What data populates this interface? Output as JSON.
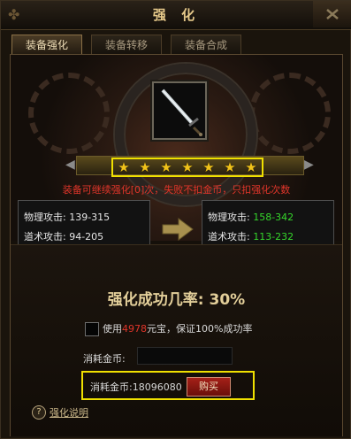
{
  "window": {
    "title": "强 化"
  },
  "tabs": [
    {
      "label": "装备强化",
      "active": true
    },
    {
      "label": "装备转移",
      "active": false
    },
    {
      "label": "装备合成",
      "active": false
    }
  ],
  "item": {
    "icon": "sword-icon"
  },
  "stars": {
    "count": 7
  },
  "notice": "装备可继续强化[0]次，失败不扣金币，只扣强化次数",
  "current_stats": [
    {
      "label": "物理攻击:",
      "value": "139-315"
    },
    {
      "label": "道术攻击:",
      "value": "94-205"
    }
  ],
  "next_stats": [
    {
      "label": "物理攻击:",
      "value": "158-342"
    },
    {
      "label": "道术攻击:",
      "value": "113-232"
    }
  ],
  "success_rate_text": "强化成功几率: 30%",
  "use_option": {
    "prefix": "使用",
    "amount": "4978",
    "suffix": "元宝，保证100%成功率"
  },
  "cost": {
    "label": "消耗金币:",
    "value_label": "消耗金币:",
    "value": "18096080"
  },
  "buy_label": "购买",
  "help_label": "强化说明",
  "colors": {
    "accent_gold": "#e3cf9a",
    "warning_red": "#e0352a",
    "increase_green": "#35d62b",
    "highlight_yellow": "#f0e000"
  }
}
